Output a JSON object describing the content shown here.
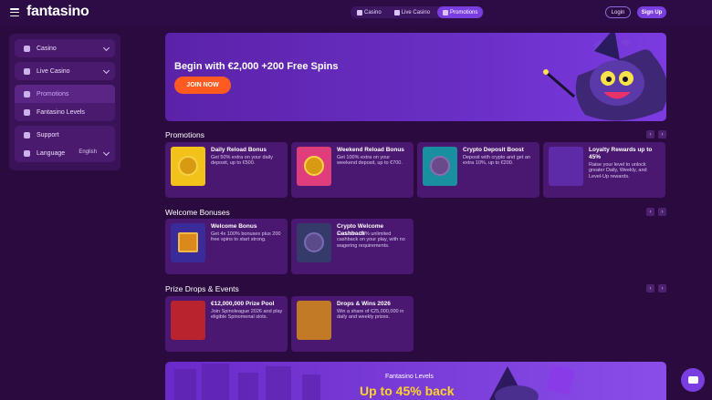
{
  "header": {
    "logo": "fantasino",
    "tabs": [
      {
        "label": "Casino",
        "icon": "casino-icon"
      },
      {
        "label": "Live Casino",
        "icon": "live-casino-icon"
      },
      {
        "label": "Promotions",
        "icon": "gift-icon"
      }
    ],
    "login_label": "Login",
    "signup_label": "Sign Up"
  },
  "sidebar": {
    "items": [
      {
        "label": "Casino",
        "icon": "casino-icon"
      },
      {
        "label": "Live Casino",
        "icon": "live-casino-icon"
      },
      {
        "label": "Promotions",
        "icon": "gift-icon"
      },
      {
        "label": "Fantasino Levels",
        "icon": "target-icon"
      },
      {
        "label": "Support",
        "icon": "support-icon"
      },
      {
        "label": "Language",
        "icon": "globe-icon",
        "value": "English"
      }
    ]
  },
  "hero": {
    "title": "Begin with €2,000 +200 Free Spins",
    "cta": "JOIN NOW"
  },
  "sections": {
    "promotions": {
      "title": "Promotions",
      "cards": [
        {
          "title": "Daily Reload Bonus",
          "desc": "Get 50% extra on your daily deposit, up to €500."
        },
        {
          "title": "Weekend Reload Bonus",
          "desc": "Get 100% extra on your weekend deposit, up to €700."
        },
        {
          "title": "Crypto Deposit Boost",
          "desc": "Deposit with crypto and get an extra 10%, up to €200."
        },
        {
          "title": "Loyalty Rewards up to 45%",
          "desc": "Raise your level to unlock greater Daily, Weekly, and Level-Up rewards."
        }
      ]
    },
    "welcome": {
      "title": "Welcome Bonuses",
      "cards": [
        {
          "title": "Welcome Bonus",
          "desc": "Get 4x 100% bonuses plus 200 free spins to start strong."
        },
        {
          "title": "Crypto Welcome Cashback",
          "desc": "Exclusive 20% unlimited cashback on your play, with no wagering requirements."
        }
      ]
    },
    "prize": {
      "title": "Prize Drops & Events",
      "cards": [
        {
          "title": "€12,000,000 Prize Pool",
          "desc": "Join Spinoleague 2026 and play eligible Spinomenal slots."
        },
        {
          "title": "Drops & Wins 2026",
          "desc": "Win a share of €25,000,000 in daily and weekly prizes."
        }
      ]
    }
  },
  "bottom_banner": {
    "title": "Fantasino Levels",
    "headline": "Up to 45% back"
  },
  "colors": {
    "accent": "#7a3ee0",
    "cta": "#ff5a1f",
    "background": "#2a0a3f"
  }
}
